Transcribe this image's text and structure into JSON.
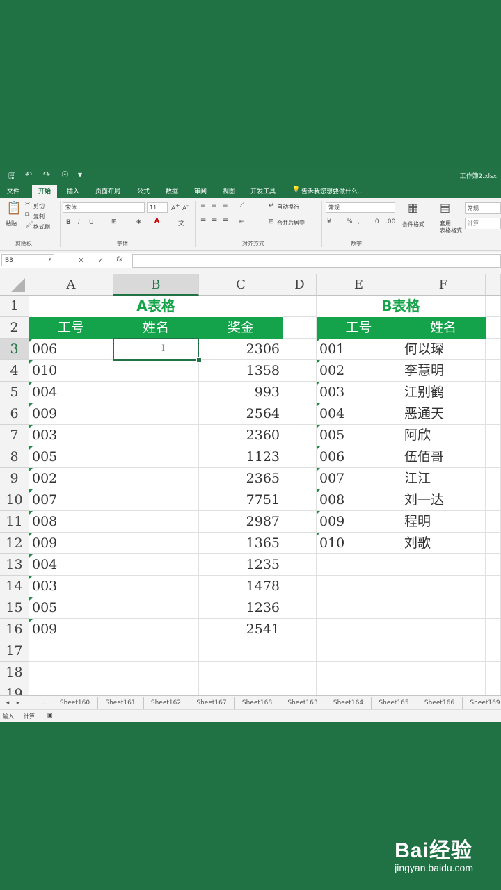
{
  "window": {
    "filename": "工作簿2.xlsx"
  },
  "tabs": [
    "文件",
    "开始",
    "插入",
    "页面布局",
    "公式",
    "数据",
    "审阅",
    "视图",
    "开发工具"
  ],
  "tell_me": "告诉我您想要做什么...",
  "ribbon": {
    "clipboard": {
      "paste": "粘贴",
      "cut": "剪切",
      "copy": "复制",
      "format_painter": "格式刷",
      "group": "剪贴板"
    },
    "font": {
      "name": "宋体",
      "size": "11",
      "group": "字体"
    },
    "alignment": {
      "wrap": "自动换行",
      "merge": "合并后居中",
      "group": "对齐方式"
    },
    "number": {
      "format": "常规",
      "group": "数字"
    },
    "styles": {
      "conditional": "条件格式",
      "table": "套用\n表格格式",
      "normal": "常规",
      "calc": "计算"
    }
  },
  "formula_bar": {
    "name_box": "B3",
    "fx": "fx",
    "cancel": "✕",
    "enter": "✓"
  },
  "columns": [
    "A",
    "B",
    "C",
    "D",
    "E",
    "F"
  ],
  "rows": [
    "1",
    "2",
    "3",
    "4",
    "5",
    "6",
    "7",
    "8",
    "9",
    "10",
    "11",
    "12",
    "13",
    "14",
    "15",
    "16",
    "17",
    "18",
    "19"
  ],
  "table_a": {
    "title": "A表格",
    "headers": [
      "工号",
      "姓名",
      "奖金"
    ],
    "ids": [
      "006",
      "010",
      "004",
      "009",
      "003",
      "005",
      "002",
      "007",
      "008",
      "009",
      "004",
      "003",
      "005",
      "009"
    ],
    "bonus": [
      "2306",
      "1358",
      "993",
      "2564",
      "2360",
      "1123",
      "2365",
      "7751",
      "2987",
      "1365",
      "1235",
      "1478",
      "1236",
      "2541"
    ]
  },
  "table_b": {
    "title": "B表格",
    "headers": [
      "工号",
      "姓名"
    ],
    "ids": [
      "001",
      "002",
      "003",
      "004",
      "005",
      "006",
      "007",
      "008",
      "009",
      "010"
    ],
    "names": [
      "何以琛",
      "李慧明",
      "江别鹤",
      "恶通天",
      "阿欣",
      "伍佰哥",
      "江江",
      "刘一达",
      "程明",
      "刘歌"
    ]
  },
  "sheets": [
    "Sheet160",
    "Sheet161",
    "Sheet162",
    "Sheet167",
    "Sheet168",
    "Sheet163",
    "Sheet164",
    "Sheet165",
    "Sheet166",
    "Sheet169"
  ],
  "status": {
    "mode": "输入",
    "calc": "计算"
  },
  "watermark": {
    "brand": "Bai经验",
    "url": "jingyan.baidu.com"
  },
  "colors": {
    "excel_green": "#217346",
    "header_fill": "#14a24a",
    "title_text": "#16a34a"
  }
}
